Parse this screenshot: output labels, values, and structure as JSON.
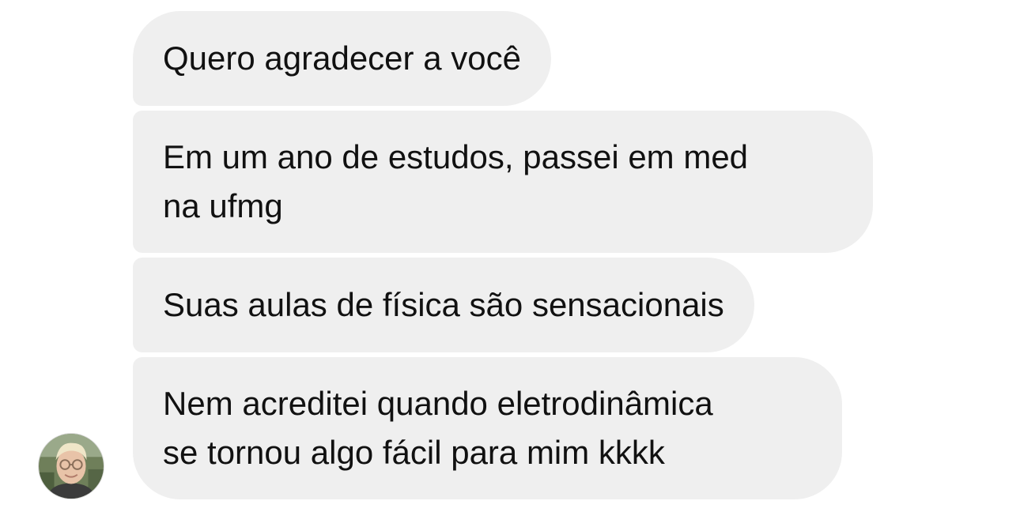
{
  "messages": [
    {
      "text": "Quero agradecer a você"
    },
    {
      "text": "Em um ano de estudos, passei em med\nna ufmg"
    },
    {
      "text": "Suas aulas de física são sensacionais"
    },
    {
      "text": "Nem acreditei quando eletrodinâmica\nse tornou algo fácil para mim kkkk"
    }
  ],
  "colors": {
    "bubble_background": "#efefef",
    "text": "#111111",
    "page_background": "#ffffff"
  },
  "icons": {
    "sender_avatar": "profile-photo"
  }
}
